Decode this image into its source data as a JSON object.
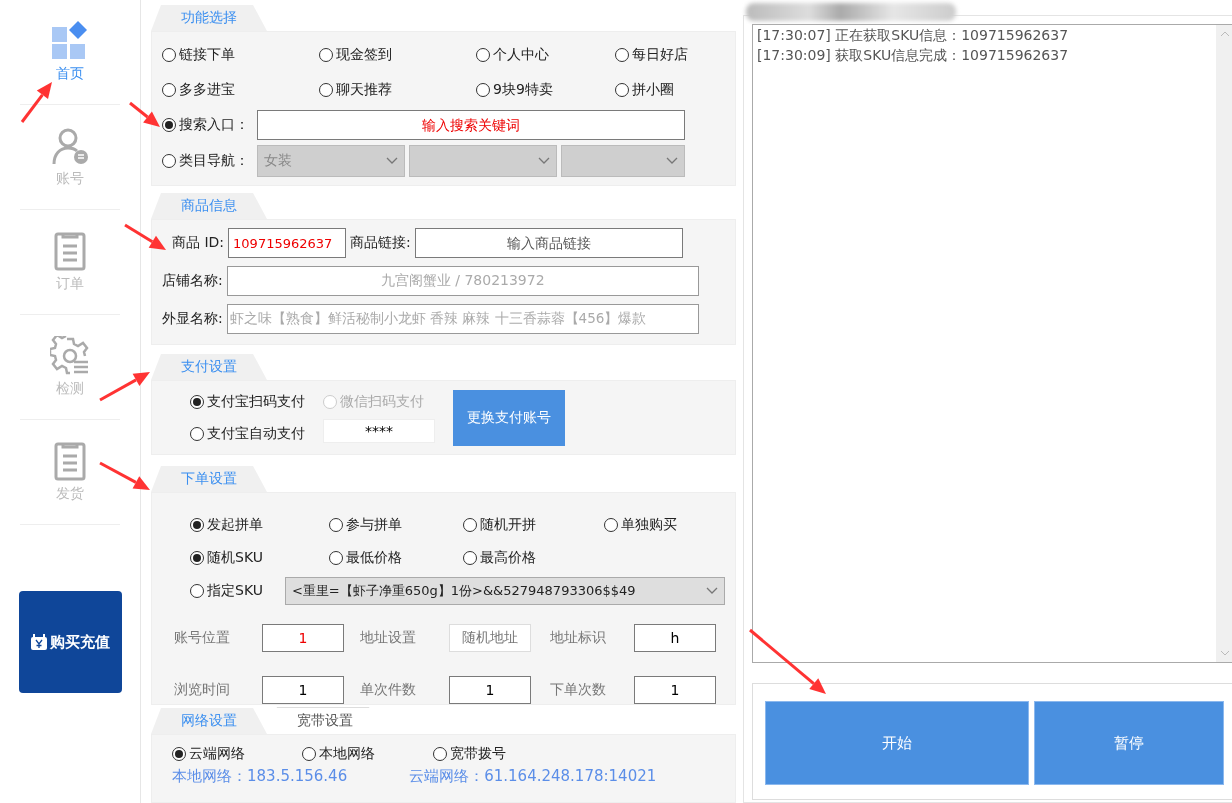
{
  "sidebar": {
    "items": [
      {
        "label": "首页",
        "kind": "grid",
        "selected": true
      },
      {
        "label": "账号",
        "kind": "person",
        "selected": false
      },
      {
        "label": "订单",
        "kind": "clipboard",
        "selected": false
      },
      {
        "label": "检测",
        "kind": "gear",
        "selected": false
      },
      {
        "label": "发货",
        "kind": "clipboard",
        "selected": false
      }
    ],
    "buy_button": "购买充值"
  },
  "function_select": {
    "tab": "功能选择",
    "options": [
      {
        "label": "链接下单",
        "selected": false
      },
      {
        "label": "现金签到",
        "selected": false
      },
      {
        "label": "个人中心",
        "selected": false
      },
      {
        "label": "每日好店",
        "selected": false
      },
      {
        "label": "多多进宝",
        "selected": false
      },
      {
        "label": "聊天推荐",
        "selected": false
      },
      {
        "label": "9块9特卖",
        "selected": false
      },
      {
        "label": "拼小圈",
        "selected": false
      }
    ],
    "search": {
      "label": "搜索入口：",
      "selected": true,
      "placeholder": "输入搜索关键词"
    },
    "category": {
      "label": "类目导航：",
      "selected": false,
      "dropdowns": [
        {
          "value": "女装",
          "disabled": true
        },
        {
          "disabled": true
        },
        {
          "disabled": true
        }
      ]
    }
  },
  "product_info": {
    "tab": "商品信息",
    "id": {
      "label": "商品 ID:",
      "value": "109715962637"
    },
    "link": {
      "label": "商品链接:",
      "placeholder": "输入商品链接"
    },
    "shop": {
      "label": "店铺名称:",
      "value": "九宫阁蟹业 / 780213972",
      "disabled": true
    },
    "display_name": {
      "label": "外显名称:",
      "value": "虾之味【熟食】鲜活秘制小龙虾 香辣 麻辣 十三香蒜蓉【456】爆款",
      "disabled": true
    }
  },
  "payment": {
    "tab": "支付设置",
    "options": [
      {
        "label": "支付宝扫码支付",
        "selected": true
      },
      {
        "label": "支付宝自动支付",
        "selected": false
      }
    ],
    "wechat": {
      "label": "微信扫码支付",
      "selected": false,
      "disabled": true
    },
    "password": "****",
    "button": "更换支付账号"
  },
  "order": {
    "tab": "下单设置",
    "mode_options": [
      {
        "label": "发起拼单",
        "selected": true
      },
      {
        "label": "参与拼单",
        "selected": false
      },
      {
        "label": "随机开拼",
        "selected": false
      },
      {
        "label": "单独购买",
        "selected": false
      }
    ],
    "sku_options": [
      {
        "label": "随机SKU",
        "selected": true
      },
      {
        "label": "最低价格",
        "selected": false
      },
      {
        "label": "最高价格",
        "selected": false
      }
    ],
    "specify_sku": {
      "label": "指定SKU",
      "selected": false,
      "dropdown": "<重里=【虾子净重650g】1份>&&527948793306$$49"
    },
    "fields": [
      {
        "label": "账号位置",
        "value": "1",
        "emphasis": true,
        "readonly": false
      },
      {
        "label": "地址设置",
        "value": "随机地址",
        "emphasis": false,
        "readonly": true
      },
      {
        "label": "地址标识",
        "value": "h",
        "emphasis": false,
        "readonly": false
      },
      {
        "label": "浏览时间",
        "value": "1",
        "emphasis": false,
        "readonly": false
      },
      {
        "label": "单次件数",
        "value": "1",
        "emphasis": false,
        "readonly": false
      },
      {
        "label": "下单次数",
        "value": "1",
        "emphasis": false,
        "readonly": false
      }
    ]
  },
  "network": {
    "tabs": [
      {
        "label": "网络设置",
        "selected": true
      },
      {
        "label": "宽带设置",
        "selected": false
      }
    ],
    "options": [
      {
        "label": "云端网络",
        "selected": true
      },
      {
        "label": "本地网络",
        "selected": false
      },
      {
        "label": "宽带拨号",
        "selected": false
      }
    ],
    "local_ip": "本地网络：183.5.156.46",
    "cloud_ip": "云端网络：61.164.248.178:14021"
  },
  "log": {
    "lines": [
      "[17:30:07] 正在获取SKU信息：109715962637",
      "[17:30:09] 获取SKU信息完成：109715962637"
    ]
  },
  "buttons": [
    "开始",
    "暂停"
  ]
}
